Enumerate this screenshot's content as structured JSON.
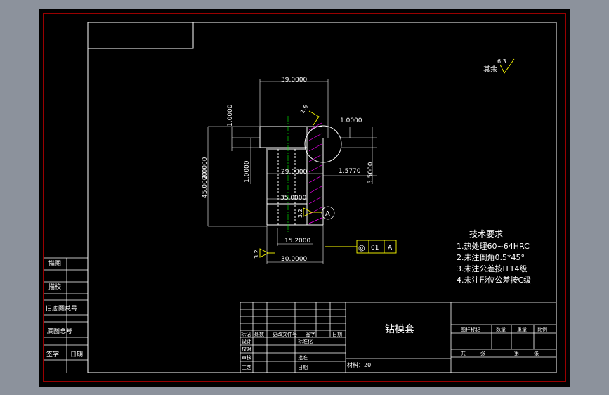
{
  "colors": {
    "backdrop": "#8c929c",
    "paper": "#000000",
    "outer_frame": "#ff0000",
    "line": "#ffffff",
    "dim": "#00ffff",
    "text": "#ffffff",
    "accent": "#ffff00",
    "center": "#00ff00",
    "hatch": "#ff00ff"
  },
  "dimensions": {
    "top_width": "39.0000",
    "small_height_top": "1.0000",
    "right_small": "1.0000",
    "left_small": "1.0000",
    "tall_left": "2.0000",
    "overall_height": "45.0000",
    "bore_width": "29.0000",
    "offset": "1.5770",
    "right_height": "5.5000",
    "mid_width": "35.0000",
    "small_bottom": "15.2000",
    "bottom_width": "30.0000"
  },
  "surface_finish": {
    "global_value": "6.3",
    "global_label": "其余",
    "top_value": "1.6",
    "left_value": "3.2",
    "bottom_value": "3.2"
  },
  "datum": {
    "label": "A",
    "tolerance_symbol": "◎",
    "tolerance_value": "01",
    "tolerance_datum": "A"
  },
  "tech_requirements": {
    "title": "技术要求",
    "items": [
      "1.热处理60~64HRC",
      "2.未注倒角0.5*45°",
      "3.未注公差按IT14级",
      "4.未注形位公差按C级"
    ]
  },
  "title_block": {
    "part_name": "钻模套",
    "material": "材料：20",
    "header_cells": [
      "标记",
      "处数",
      "更改文件号",
      "签字",
      "日期"
    ],
    "left_cells": [
      "设计",
      "校对",
      "审核",
      "工艺"
    ],
    "std_cells": [
      "标准化",
      "批准",
      "日期"
    ],
    "right_header": [
      "图样标记",
      "数量",
      "重量",
      "比例"
    ],
    "right_bottom": [
      "共",
      "张",
      "第",
      "张"
    ]
  },
  "side_table": {
    "rows": [
      "描图",
      "描校",
      "旧底图总号",
      "底图总号",
      "签字",
      "日期"
    ]
  }
}
